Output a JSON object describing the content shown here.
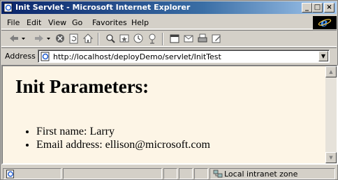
{
  "window": {
    "title": "Init Servlet - Microsoft Internet Explorer"
  },
  "menu": [
    "File",
    "Edit",
    "View",
    "Go",
    "Favorites",
    "Help"
  ],
  "address": {
    "label": "Address",
    "url": "http://localhost/deployDemo/servlet/InitTest"
  },
  "page": {
    "heading": "Init Parameters:",
    "items": [
      "First name: Larry",
      "Email address: ellison@microsoft.com"
    ]
  },
  "status": {
    "zone": "Local intranet zone"
  }
}
